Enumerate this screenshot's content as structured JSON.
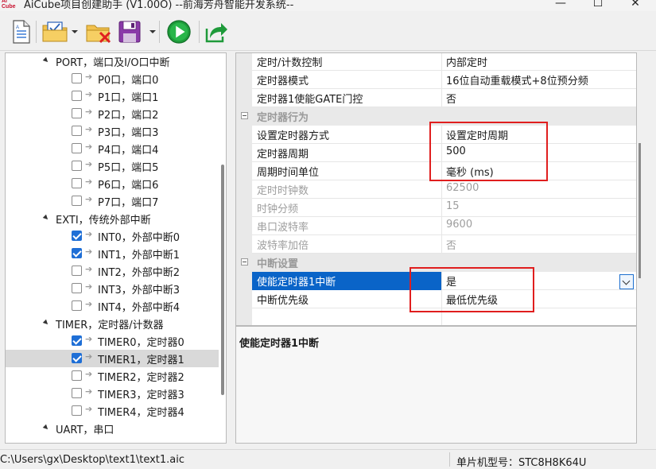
{
  "window": {
    "title": "AiCube项目创建助手 (V1.00O) --前海芳舟智能开发系统--",
    "icon_text_top": "Ai",
    "icon_text_bottom": "Cube",
    "minimize_glyph": "—",
    "maximize_glyph": "☐",
    "close_glyph": "✕"
  },
  "toolbar": {
    "buttons": [
      {
        "name": "new-file",
        "icon": "document-icon"
      },
      {
        "name": "open-project",
        "icon": "folder-check-icon"
      },
      {
        "name": "close-project",
        "icon": "folder-delete-icon"
      },
      {
        "name": "save",
        "icon": "floppy-disk-icon"
      },
      {
        "name": "run",
        "icon": "play-icon"
      },
      {
        "name": "export",
        "icon": "export-arrow-icon"
      }
    ]
  },
  "tree": {
    "groups": [
      {
        "label": "PORT，端口及I/O口中断",
        "items": [
          {
            "label": "P0口，端口0",
            "checked": false
          },
          {
            "label": "P1口，端口1",
            "checked": false
          },
          {
            "label": "P2口，端口2",
            "checked": false
          },
          {
            "label": "P3口，端口3",
            "checked": false
          },
          {
            "label": "P4口，端口4",
            "checked": false
          },
          {
            "label": "P5口，端口5",
            "checked": false
          },
          {
            "label": "P6口，端口6",
            "checked": false
          },
          {
            "label": "P7口，端口7",
            "checked": false
          }
        ]
      },
      {
        "label": "EXTI，传统外部中断",
        "items": [
          {
            "label": "INT0，外部中断0",
            "checked": true
          },
          {
            "label": "INT1，外部中断1",
            "checked": true
          },
          {
            "label": "INT2，外部中断2",
            "checked": false
          },
          {
            "label": "INT3，外部中断3",
            "checked": false
          },
          {
            "label": "INT4，外部中断4",
            "checked": false
          }
        ]
      },
      {
        "label": "TIMER，定时器/计数器",
        "items": [
          {
            "label": "TIMER0，定时器0",
            "checked": true
          },
          {
            "label": "TIMER1，定时器1",
            "checked": true,
            "selected": true
          },
          {
            "label": "TIMER2，定时器2",
            "checked": false
          },
          {
            "label": "TIMER3，定时器3",
            "checked": false
          },
          {
            "label": "TIMER4，定时器4",
            "checked": false
          }
        ]
      },
      {
        "label": "UART，串口",
        "items": []
      }
    ]
  },
  "properties": {
    "rows": [
      {
        "kind": "prop",
        "name": "定时/计数控制",
        "value": "内部定时"
      },
      {
        "kind": "prop",
        "name": "定时器模式",
        "value": "16位自动重载模式+8位预分频"
      },
      {
        "kind": "prop",
        "name": "定时器1使能GATE门控",
        "value": "否"
      },
      {
        "kind": "category",
        "name": "定时器行为"
      },
      {
        "kind": "prop",
        "name": "设置定时器方式",
        "value": "设置定时周期"
      },
      {
        "kind": "prop",
        "name": "定时器周期",
        "value": "500"
      },
      {
        "kind": "prop",
        "name": "周期时间单位",
        "value": "毫秒 (ms)"
      },
      {
        "kind": "prop",
        "name": "定时时钟数",
        "value": "62500",
        "disabled": true
      },
      {
        "kind": "prop",
        "name": "时钟分频",
        "value": "15",
        "disabled": true
      },
      {
        "kind": "prop",
        "name": "串口波特率",
        "value": "9600",
        "disabled": true
      },
      {
        "kind": "prop",
        "name": "波特率加倍",
        "value": "否",
        "disabled": true
      },
      {
        "kind": "category",
        "name": "中断设置"
      },
      {
        "kind": "prop",
        "name": "使能定时器1中断",
        "value": "是",
        "selected": true
      },
      {
        "kind": "prop",
        "name": "中断优先级",
        "value": "最低优先级"
      }
    ]
  },
  "description": {
    "title": "使能定时器1中断"
  },
  "status": {
    "path": "C:\\Users\\gx\\Desktop\\text1\\text1.aic",
    "chip": "单片机型号：STC8H8K64U"
  },
  "colors": {
    "selection_blue": "#0a64c8",
    "highlight_red": "#e01e1e",
    "check_blue": "#1f6fd6"
  }
}
